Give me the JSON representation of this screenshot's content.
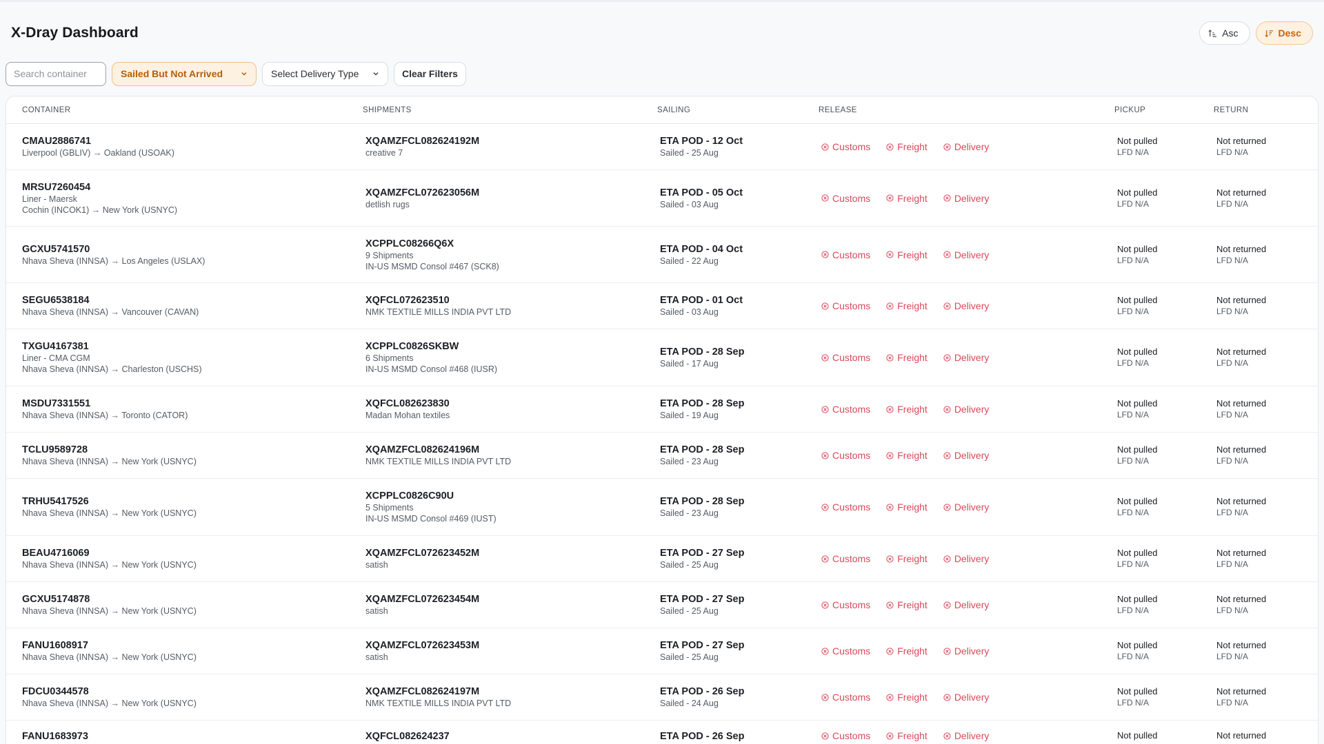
{
  "header": {
    "title": "X-Dray Dashboard",
    "sort_asc": "Asc",
    "sort_desc": "Desc"
  },
  "filters": {
    "search_placeholder": "Search container",
    "status": "Sailed But Not Arrived",
    "delivery_type": "Select Delivery Type",
    "clear": "Clear Filters"
  },
  "colors": {
    "accent": "#c4640f",
    "release_blocked": "#d9485a"
  },
  "table": {
    "columns": [
      "Container",
      "Shipments",
      "Sailing",
      "Release",
      "Pickup",
      "Return"
    ],
    "release_labels": [
      "Customs",
      "Freight",
      "Delivery"
    ],
    "rows": [
      {
        "container": "CMAU2886741",
        "info": [
          "Liverpool (GBLIV) → Oakland (USOAK)"
        ],
        "shipment": "XQAMZFCL082624192M",
        "shipment_info": [
          "creative 7"
        ],
        "eta": "ETA POD - 12 Oct",
        "sailed": "Sailed - 25 Aug",
        "pickup": "Not pulled",
        "pickup_lfd": "LFD N/A",
        "return": "Not returned",
        "return_lfd": "LFD N/A",
        "h": 67
      },
      {
        "container": "MRSU7260454",
        "info": [
          "Liner - Maersk",
          "Cochin (INCOK1) → New York (USNYC)"
        ],
        "shipment": "XQAMZFCL072623056M",
        "shipment_info": [
          "detlish rugs"
        ],
        "eta": "ETA POD - 05 Oct",
        "sailed": "Sailed - 03 Aug",
        "pickup": "Not pulled",
        "pickup_lfd": "LFD N/A",
        "return": "Not returned",
        "return_lfd": "LFD N/A",
        "h": 82
      },
      {
        "container": "GCXU5741570",
        "info": [
          "Nhava Sheva (INNSA) → Los Angeles (USLAX)"
        ],
        "shipment": "XCPPLC08266Q6X",
        "shipment_info": [
          "9 Shipments",
          "IN-US MSMD Consol #467 (SCK8)"
        ],
        "eta": "ETA POD - 04 Oct",
        "sailed": "Sailed - 22 Aug",
        "pickup": "Not pulled",
        "pickup_lfd": "LFD N/A",
        "return": "Not returned",
        "return_lfd": "LFD N/A",
        "h": 82
      },
      {
        "container": "SEGU6538184",
        "info": [
          "Nhava Sheva (INNSA) → Vancouver (CAVAN)"
        ],
        "shipment": "XQFCL072623510",
        "shipment_info": [
          "NMK TEXTILE MILLS INDIA PVT LTD"
        ],
        "eta": "ETA POD - 01 Oct",
        "sailed": "Sailed - 03 Aug",
        "pickup": "Not pulled",
        "pickup_lfd": "LFD N/A",
        "return": "Not returned",
        "return_lfd": "LFD N/A",
        "h": 67
      },
      {
        "container": "TXGU4167381",
        "info": [
          "Liner - CMA CGM",
          "Nhava Sheva (INNSA) → Charleston (USCHS)"
        ],
        "shipment": "XCPPLC0826SKBW",
        "shipment_info": [
          "6 Shipments",
          "IN-US MSMD Consol #468 (IUSR)"
        ],
        "eta": "ETA POD - 28 Sep",
        "sailed": "Sailed - 17 Aug",
        "pickup": "Not pulled",
        "pickup_lfd": "LFD N/A",
        "return": "Not returned",
        "return_lfd": "LFD N/A",
        "h": 83
      },
      {
        "container": "MSDU7331551",
        "info": [
          "Nhava Sheva (INNSA) → Toronto (CATOR)"
        ],
        "shipment": "XQFCL082623830",
        "shipment_info": [
          "Madan Mohan textiles"
        ],
        "eta": "ETA POD - 28 Sep",
        "sailed": "Sailed - 19 Aug",
        "pickup": "Not pulled",
        "pickup_lfd": "LFD N/A",
        "return": "Not returned",
        "return_lfd": "LFD N/A",
        "h": 67
      },
      {
        "container": "TCLU9589728",
        "info": [
          "Nhava Sheva (INNSA) → New York (USNYC)"
        ],
        "shipment": "XQAMZFCL082624196M",
        "shipment_info": [
          "NMK TEXTILE MILLS INDIA PVT LTD"
        ],
        "eta": "ETA POD - 28 Sep",
        "sailed": "Sailed - 23 Aug",
        "pickup": "Not pulled",
        "pickup_lfd": "LFD N/A",
        "return": "Not returned",
        "return_lfd": "LFD N/A",
        "h": 67
      },
      {
        "container": "TRHU5417526",
        "info": [
          "Nhava Sheva (INNSA) → New York (USNYC)"
        ],
        "shipment": "XCPPLC0826C90U",
        "shipment_info": [
          "5 Shipments",
          "IN-US MSMD Consol #469 (IUST)"
        ],
        "eta": "ETA POD - 28 Sep",
        "sailed": "Sailed - 23 Aug",
        "pickup": "Not pulled",
        "pickup_lfd": "LFD N/A",
        "return": "Not returned",
        "return_lfd": "LFD N/A",
        "h": 83
      },
      {
        "container": "BEAU4716069",
        "info": [
          "Nhava Sheva (INNSA) → New York (USNYC)"
        ],
        "shipment": "XQAMZFCL072623452M",
        "shipment_info": [
          "satish"
        ],
        "eta": "ETA POD - 27 Sep",
        "sailed": "Sailed - 25 Aug",
        "pickup": "Not pulled",
        "pickup_lfd": "LFD N/A",
        "return": "Not returned",
        "return_lfd": "LFD N/A",
        "h": 67
      },
      {
        "container": "GCXU5174878",
        "info": [
          "Nhava Sheva (INNSA) → New York (USNYC)"
        ],
        "shipment": "XQAMZFCL072623454M",
        "shipment_info": [
          "satish"
        ],
        "eta": "ETA POD - 27 Sep",
        "sailed": "Sailed - 25 Aug",
        "pickup": "Not pulled",
        "pickup_lfd": "LFD N/A",
        "return": "Not returned",
        "return_lfd": "LFD N/A",
        "h": 67
      },
      {
        "container": "FANU1608917",
        "info": [
          "Nhava Sheva (INNSA) → New York (USNYC)"
        ],
        "shipment": "XQAMZFCL072623453M",
        "shipment_info": [
          "satish"
        ],
        "eta": "ETA POD - 27 Sep",
        "sailed": "Sailed - 25 Aug",
        "pickup": "Not pulled",
        "pickup_lfd": "LFD N/A",
        "return": "Not returned",
        "return_lfd": "LFD N/A",
        "h": 67
      },
      {
        "container": "FDCU0344578",
        "info": [
          "Nhava Sheva (INNSA) → New York (USNYC)"
        ],
        "shipment": "XQAMZFCL082624197M",
        "shipment_info": [
          "NMK TEXTILE MILLS INDIA PVT LTD"
        ],
        "eta": "ETA POD - 26 Sep",
        "sailed": "Sailed - 24 Aug",
        "pickup": "Not pulled",
        "pickup_lfd": "LFD N/A",
        "return": "Not returned",
        "return_lfd": "LFD N/A",
        "h": 67
      },
      {
        "container": "FANU1683973",
        "info": [],
        "shipment": "XQFCL082624237",
        "shipment_info": [],
        "eta": "ETA POD - 26 Sep",
        "sailed": "",
        "pickup": "Not pulled",
        "pickup_lfd": "",
        "return": "Not returned",
        "return_lfd": "",
        "h": 67
      }
    ]
  }
}
